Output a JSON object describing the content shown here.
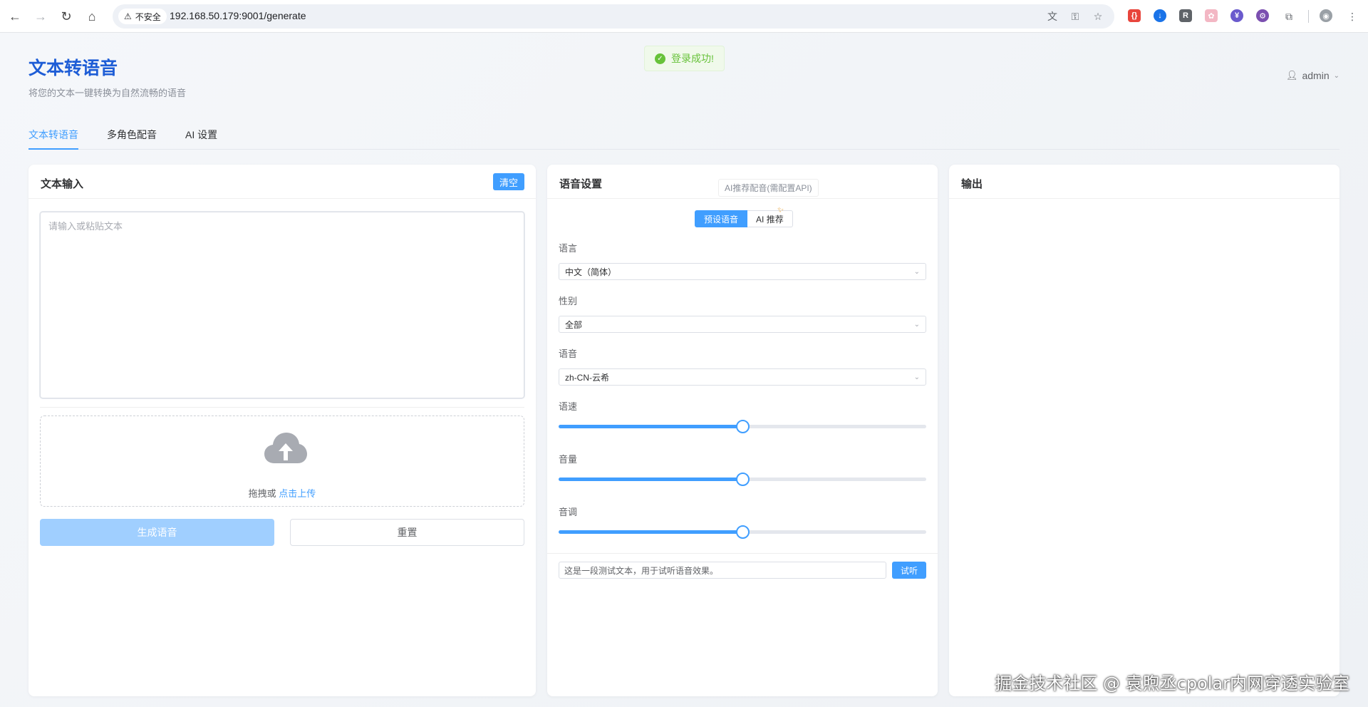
{
  "browser": {
    "insecure_label": "不安全",
    "url": "192.168.50.179:9001/generate"
  },
  "header": {
    "title": "文本转语音",
    "subtitle": "将您的文本一键转换为自然流畅的语音",
    "toast": "登录成功!",
    "user": "admin"
  },
  "tabs": [
    {
      "label": "文本转语音"
    },
    {
      "label": "多角色配音"
    },
    {
      "label": "AI 设置"
    }
  ],
  "input_card": {
    "title": "文本输入",
    "clear_label": "清空",
    "textarea_placeholder": "请输入或粘贴文本",
    "upload_prefix": "拖拽或 ",
    "upload_link": "点击上传",
    "generate_label": "生成语音",
    "reset_label": "重置"
  },
  "voice_card": {
    "title": "语音设置",
    "tooltip": "AI推荐配音(需配置API)",
    "mode_preset": "预设语音",
    "mode_ai": "AI 推荐",
    "language_label": "语言",
    "language_value": "中文（简体）",
    "gender_label": "性别",
    "gender_value": "全部",
    "voice_label": "语音",
    "voice_value": "zh-CN-云希",
    "rate_label": "语速",
    "rate_percent": 50,
    "volume_label": "音量",
    "volume_percent": 50,
    "pitch_label": "音调",
    "pitch_percent": 50,
    "preview_text": "这是一段测试文本，用于试听语音效果。",
    "listen_label": "试听"
  },
  "output_card": {
    "title": "输出"
  },
  "watermark": "掘金技术社区 @ 袁煦丞cpolar内网穿透实验室",
  "colors": {
    "primary": "#409eff",
    "title_blue": "#1e5dd6",
    "success": "#67c23a"
  }
}
